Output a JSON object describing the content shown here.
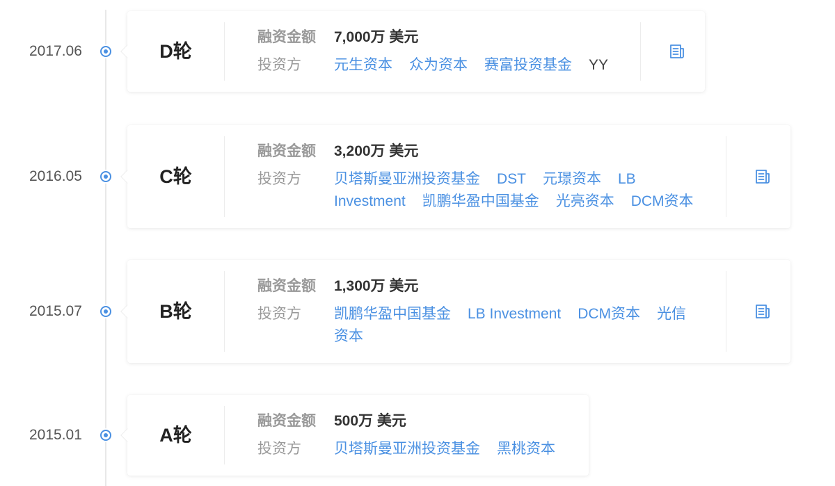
{
  "theme": {
    "accent": "#4a90e2",
    "text_strong": "#222222",
    "text_value": "#333333",
    "text_label": "#999999",
    "text_date": "#555555",
    "text_plain": "#444444",
    "divider": "#ececec",
    "timeline": "#e8e8e8"
  },
  "icons": {
    "timeline_marker": "timeline-dot-icon",
    "news": "news-icon"
  },
  "labels": {
    "amount": "融资金额",
    "investors": "投资方"
  },
  "rounds": [
    {
      "date": "2017.06",
      "round": "D轮",
      "amount": "7,000万 美元",
      "investors": [
        {
          "name": "元生资本",
          "linked": true
        },
        {
          "name": "众为资本",
          "linked": true
        },
        {
          "name": "赛富投资基金",
          "linked": true
        },
        {
          "name": "YY",
          "linked": false
        }
      ],
      "has_news": true
    },
    {
      "date": "2016.05",
      "round": "C轮",
      "amount": "3,200万 美元",
      "investors": [
        {
          "name": "贝塔斯曼亚洲投资基金",
          "linked": true
        },
        {
          "name": "DST",
          "linked": true
        },
        {
          "name": "元璟资本",
          "linked": true
        },
        {
          "name": "LB Investment",
          "linked": true
        },
        {
          "name": "凯鹏华盈中国基金",
          "linked": true
        },
        {
          "name": "光亮资本",
          "linked": true
        },
        {
          "name": "DCM资本",
          "linked": true
        }
      ],
      "has_news": true
    },
    {
      "date": "2015.07",
      "round": "B轮",
      "amount": "1,300万 美元",
      "investors": [
        {
          "name": "凯鹏华盈中国基金",
          "linked": true
        },
        {
          "name": "LB Investment",
          "linked": true
        },
        {
          "name": "DCM资本",
          "linked": true
        },
        {
          "name": "光信资本",
          "linked": true
        }
      ],
      "has_news": true
    },
    {
      "date": "2015.01",
      "round": "A轮",
      "amount": "500万 美元",
      "investors": [
        {
          "name": "贝塔斯曼亚洲投资基金",
          "linked": true
        },
        {
          "name": "黑桃资本",
          "linked": true
        }
      ],
      "has_news": false
    }
  ]
}
